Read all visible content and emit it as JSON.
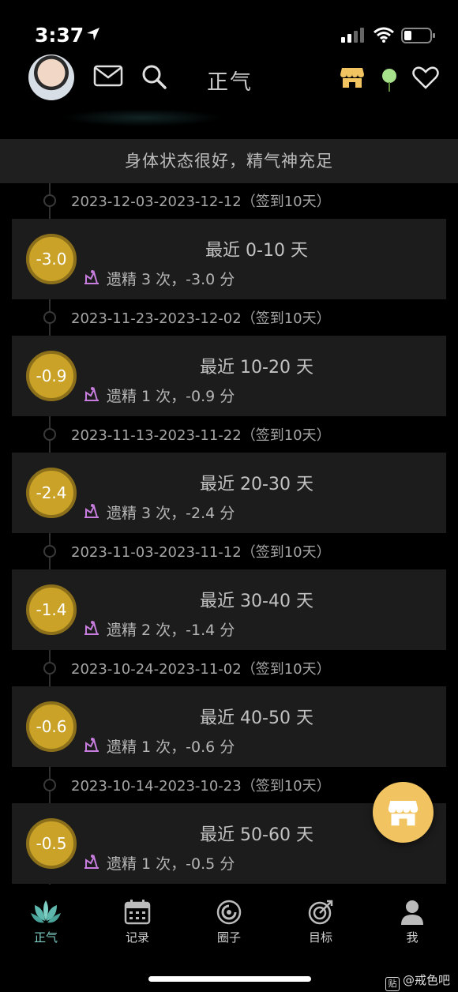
{
  "status_bar": {
    "time": "3:37"
  },
  "header": {
    "title": "正气"
  },
  "banner": {
    "text": "身体状态很好，精气神充足"
  },
  "entries": [
    {
      "date_range": "2023-12-03-2023-12-12（签到10天）",
      "score": "-3.0",
      "period": "最近 0-10 天",
      "detail": "遗精 3 次，-3.0 分"
    },
    {
      "date_range": "2023-11-23-2023-12-02（签到10天）",
      "score": "-0.9",
      "period": "最近 10-20 天",
      "detail": "遗精 1 次，-0.9 分"
    },
    {
      "date_range": "2023-11-13-2023-11-22（签到10天）",
      "score": "-2.4",
      "period": "最近 20-30 天",
      "detail": "遗精 3 次，-2.4 分"
    },
    {
      "date_range": "2023-11-03-2023-11-12（签到10天）",
      "score": "-1.4",
      "period": "最近 30-40 天",
      "detail": "遗精 2 次，-1.4 分"
    },
    {
      "date_range": "2023-10-24-2023-11-02（签到10天）",
      "score": "-0.6",
      "period": "最近 40-50 天",
      "detail": "遗精 1 次，-0.6 分"
    },
    {
      "date_range": "2023-10-14-2023-10-23（签到10天）",
      "score": "-0.5",
      "period": "最近 50-60 天",
      "detail": "遗精 1 次，-0.5 分"
    }
  ],
  "tabs": [
    {
      "label": "正气",
      "icon": "lotus-icon",
      "active": true
    },
    {
      "label": "记录",
      "icon": "calendar-icon",
      "active": false
    },
    {
      "label": "圈子",
      "icon": "circle-icon",
      "active": false
    },
    {
      "label": "目标",
      "icon": "target-icon",
      "active": false
    },
    {
      "label": "我",
      "icon": "user-icon",
      "active": false
    }
  ],
  "watermark": {
    "box": "贴",
    "text": "@戒色吧"
  },
  "colors": {
    "accent": "#7fd1c6",
    "badge": "#c9a227",
    "fab": "#f2c461",
    "detail_icon": "#c77dde"
  }
}
